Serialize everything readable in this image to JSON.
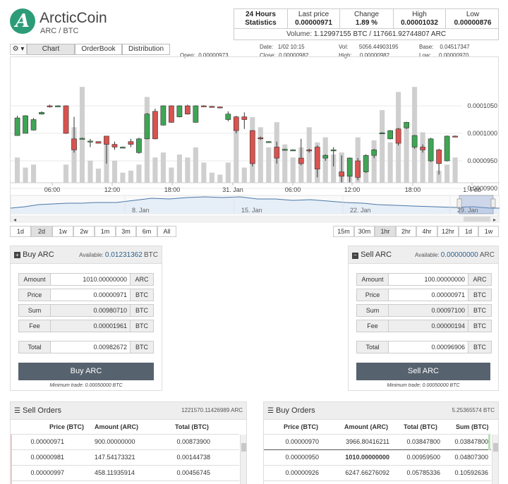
{
  "header": {
    "title": "ArcticCoin",
    "pair": "ARC / BTC",
    "logo_letter": "A"
  },
  "stats": {
    "label_line1": "24 Hours",
    "label_line2": "Statistics",
    "last_price_label": "Last price",
    "last_price": "0.00000971",
    "change_label": "Change",
    "change": "1.89 %",
    "high_label": "High",
    "high": "0.00001032",
    "low_label": "Low",
    "low": "0.00000876",
    "volume_label": "Volume:",
    "volume": "1.12997155 BTC / 117661.92744807 ARC"
  },
  "toolbar": {
    "gear_icon": "gear-icon",
    "tabs": [
      "Chart",
      "OrderBook",
      "Distribution"
    ],
    "active_tab": "Chart"
  },
  "ohlc": {
    "open_label": "Open:",
    "open": "0.00000973",
    "close_label": "Close:",
    "close": "0.00000982",
    "date_label": "Date:",
    "date": "1/02 10:15",
    "vol_label": "Vol:",
    "vol": "5056.44903195",
    "high_label": "High:",
    "high": "0.00000982",
    "base_label": "Base:",
    "base": "0.04517347",
    "low_label": "Low:",
    "low": "0.00000970"
  },
  "chart_data": {
    "type": "candlestick",
    "x_ticks": [
      "06:00",
      "12:00",
      "18:00",
      "31. Jan",
      "06:00",
      "12:00",
      "18:00",
      "1. Feb"
    ],
    "y_ticks": [
      "0.0001050",
      "0.0001000",
      "0.0000950",
      "0.0000900"
    ],
    "navigator_ticks": [
      "8. Jan",
      "15. Jan",
      "22. Jan",
      "29. Jan"
    ],
    "candles": [
      {
        "o": 996,
        "c": 1028,
        "h": 1032,
        "l": 996
      },
      {
        "o": 1000,
        "c": 1032,
        "h": 1033,
        "l": 1000
      },
      {
        "o": 1006,
        "c": 1025,
        "h": 1028,
        "l": 1005
      },
      {
        "o": 1035,
        "c": 1038,
        "h": 1040,
        "l": 1034
      },
      {
        "o": 1050,
        "c": 1049,
        "h": 1052,
        "l": 1047
      },
      {
        "o": 1050,
        "c": 1050,
        "h": 1051,
        "l": 1049
      },
      {
        "o": 1050,
        "c": 1000,
        "h": 1051,
        "l": 999
      },
      {
        "o": 990,
        "c": 970,
        "h": 1030,
        "l": 965
      },
      {
        "o": 990,
        "c": 991,
        "h": 992,
        "l": 989
      },
      {
        "o": 985,
        "c": 986,
        "h": 990,
        "l": 975
      },
      {
        "o": 985,
        "c": 982,
        "h": 985,
        "l": 982
      },
      {
        "o": 995,
        "c": 980,
        "h": 995,
        "l": 945
      },
      {
        "o": 980,
        "c": 975,
        "h": 985,
        "l": 970
      },
      {
        "o": 975,
        "c": 975,
        "h": 976,
        "l": 974
      },
      {
        "o": 985,
        "c": 980,
        "h": 990,
        "l": 975
      },
      {
        "o": 965,
        "c": 990,
        "h": 992,
        "l": 963
      },
      {
        "o": 990,
        "c": 1035,
        "h": 1037,
        "l": 989
      },
      {
        "o": 1040,
        "c": 990,
        "h": 1045,
        "l": 989
      },
      {
        "o": 1015,
        "c": 1050,
        "h": 1051,
        "l": 1014
      },
      {
        "o": 1050,
        "c": 1020,
        "h": 1051,
        "l": 1019
      },
      {
        "o": 1030,
        "c": 1050,
        "h": 1051,
        "l": 1029
      },
      {
        "o": 1050,
        "c": 1035,
        "h": 1052,
        "l": 1034
      },
      {
        "o": 1020,
        "c": 1050,
        "h": 1051,
        "l": 1019
      },
      {
        "o": 1050,
        "c": 1049,
        "h": 1051,
        "l": 1048
      },
      {
        "o": 1049,
        "c": 1048,
        "h": 1050,
        "l": 1047
      },
      {
        "o": 1048,
        "c": 1047,
        "h": 1049,
        "l": 1046
      },
      {
        "o": 1025,
        "c": 1035,
        "h": 1040,
        "l": 1022
      },
      {
        "o": 1030,
        "c": 1005,
        "h": 1032,
        "l": 1000
      },
      {
        "o": 1030,
        "c": 1025,
        "h": 1038,
        "l": 1008
      },
      {
        "o": 1005,
        "c": 945,
        "h": 1006,
        "l": 940
      },
      {
        "o": 992,
        "c": 991,
        "h": 994,
        "l": 988
      },
      {
        "o": 985,
        "c": 985,
        "h": 986,
        "l": 984
      },
      {
        "o": 975,
        "c": 955,
        "h": 985,
        "l": 945
      },
      {
        "o": 970,
        "c": 971,
        "h": 972,
        "l": 969
      },
      {
        "o": 970,
        "c": 970,
        "h": 971,
        "l": 969
      },
      {
        "o": 955,
        "c": 945,
        "h": 990,
        "l": 942
      },
      {
        "o": 970,
        "c": 969,
        "h": 972,
        "l": 965
      },
      {
        "o": 975,
        "c": 935,
        "h": 978,
        "l": 920
      },
      {
        "o": 955,
        "c": 960,
        "h": 962,
        "l": 950
      },
      {
        "o": 970,
        "c": 970,
        "h": 975,
        "l": 940
      },
      {
        "o": 930,
        "c": 922,
        "h": 960,
        "l": 910
      },
      {
        "o": 922,
        "c": 955,
        "h": 956,
        "l": 910
      },
      {
        "o": 950,
        "c": 920,
        "h": 955,
        "l": 915
      },
      {
        "o": 930,
        "c": 960,
        "h": 962,
        "l": 928
      },
      {
        "o": 960,
        "c": 970,
        "h": 972,
        "l": 955
      },
      {
        "o": 1000,
        "c": 1001,
        "h": 1002,
        "l": 999
      },
      {
        "o": 990,
        "c": 1005,
        "h": 1006,
        "l": 989
      },
      {
        "o": 1008,
        "c": 982,
        "h": 1010,
        "l": 978
      },
      {
        "o": 1010,
        "c": 1020,
        "h": 1021,
        "l": 1008
      },
      {
        "o": 975,
        "c": 996,
        "h": 997,
        "l": 972
      },
      {
        "o": 975,
        "c": 970,
        "h": 980,
        "l": 965
      },
      {
        "o": 950,
        "c": 990,
        "h": 992,
        "l": 948
      },
      {
        "o": 970,
        "c": 945,
        "h": 972,
        "l": 925
      },
      {
        "o": 950,
        "c": 995,
        "h": 996,
        "l": 949
      },
      {
        "o": 995,
        "c": 994,
        "h": 996,
        "l": 993
      }
    ],
    "volumes": [
      0.25,
      0.15,
      0.18,
      0.0,
      0.0,
      0.0,
      0.18,
      0.55,
      0.95,
      0.22,
      0.14,
      0.45,
      0.22,
      0.1,
      0.12,
      0.18,
      0.85,
      0.25,
      0.3,
      0.15,
      0.28,
      0.25,
      0.35,
      0.2,
      0.1,
      0.08,
      0.2,
      0.58,
      0.15,
      0.65,
      0.55,
      0.35,
      0.6,
      0.38,
      0.25,
      0.35,
      0.55,
      0.4,
      0.45,
      0.28,
      0.3,
      0.25,
      0.45,
      0.15,
      0.42,
      0.72,
      0.4,
      0.9,
      0.6,
      0.95,
      0.5,
      0.25,
      0.12,
      0.18,
      0.25
    ]
  },
  "range_left": [
    "1d",
    "2d",
    "1w",
    "2w",
    "1m",
    "3m",
    "6m",
    "All"
  ],
  "range_left_active": "2d",
  "range_right": [
    "15m",
    "30m",
    "1hr",
    "2hr",
    "4hr",
    "12hr",
    "1d",
    "1w"
  ],
  "range_right_active": "1hr",
  "buy": {
    "title": "Buy ARC",
    "avail_label": "Available:",
    "avail_value": "0.01231362",
    "avail_unit": "BTC",
    "amount_label": "Amount",
    "amount": "1010.00000000",
    "amount_unit": "ARC",
    "price_label": "Price",
    "price": "0.00000971",
    "price_unit": "BTC",
    "sum_label": "Sum",
    "sum": "0.00980710",
    "sum_unit": "BTC",
    "fee_label": "Fee",
    "fee": "0.00001961",
    "fee_unit": "BTC",
    "total_label": "Total",
    "total": "0.00982672",
    "total_unit": "BTC",
    "button": "Buy ARC",
    "min": "Minimum trade: 0.00050000 BTC"
  },
  "sell": {
    "title": "Sell ARC",
    "avail_label": "Available:",
    "avail_value": "0.00000000",
    "avail_unit": "ARC",
    "amount_label": "Amount",
    "amount": "100.00000000",
    "amount_unit": "ARC",
    "price_label": "Price",
    "price": "0.00000971",
    "price_unit": "BTC",
    "sum_label": "Sum",
    "sum": "0.00097100",
    "sum_unit": "BTC",
    "fee_label": "Fee",
    "fee": "0.00000194",
    "fee_unit": "BTC",
    "total_label": "Total",
    "total": "0.00096906",
    "total_unit": "BTC",
    "button": "Sell ARC",
    "min": "Minimum trade: 0.00050000 BTC"
  },
  "sell_orders": {
    "title": "Sell Orders",
    "total": "1221570.11426989 ARC",
    "headers": [
      "Price (BTC)",
      "Amount (ARC)",
      "Total (BTC)"
    ],
    "rows": [
      [
        "0.00000971",
        "900.00000000",
        "0.00873900"
      ],
      [
        "0.00000981",
        "147.54173321",
        "0.00144738"
      ],
      [
        "0.00000997",
        "458.11935914",
        "0.00456745"
      ]
    ]
  },
  "buy_orders": {
    "title": "Buy Orders",
    "total": "5.25365574 BTC",
    "headers": [
      "Price (BTC)",
      "Amount (ARC)",
      "Total (BTC)",
      "Sum (BTC)"
    ],
    "rows": [
      [
        "0.00000970",
        "3966.80416211",
        "0.03847800",
        "0.03847800"
      ],
      [
        "0.00000950",
        "1010.00000000",
        "0.00959500",
        "0.04807300"
      ],
      [
        "0.00000926",
        "6247.66276092",
        "0.05785336",
        "0.10592636"
      ]
    ]
  }
}
